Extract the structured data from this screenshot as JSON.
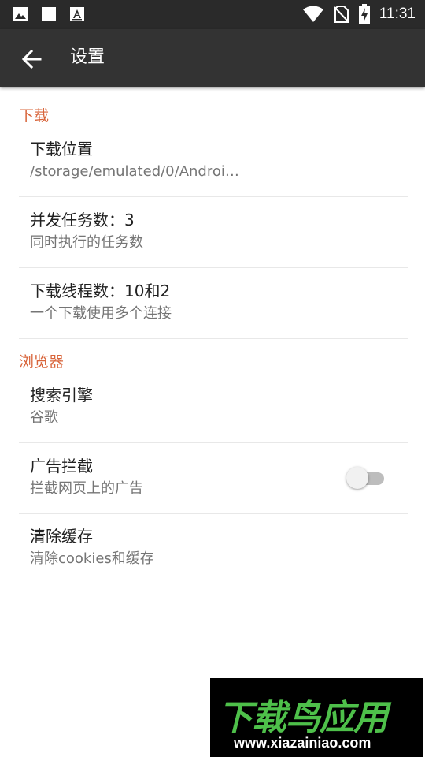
{
  "status_bar": {
    "time": "11:31",
    "left_icons": [
      "image-icon",
      "square-icon",
      "font-icon"
    ],
    "right_icons": [
      "wifi-icon",
      "no-sim-icon",
      "battery-charging-icon"
    ]
  },
  "app_bar": {
    "title": "设置",
    "back_icon": "arrow-back-icon"
  },
  "sections": {
    "download": {
      "header": "下载",
      "items": [
        {
          "title": "下载位置",
          "summary": "/storage/emulated/0/Androi…"
        },
        {
          "title": "并发任务数：3",
          "summary": "同时执行的任务数"
        },
        {
          "title": "下载线程数：10和2",
          "summary": "一个下载使用多个连接"
        }
      ]
    },
    "browser": {
      "header": "浏览器",
      "items": [
        {
          "title": "搜索引擎",
          "summary": "谷歌"
        },
        {
          "title": "广告拦截",
          "summary": "拦截网页上的广告",
          "toggle": false
        },
        {
          "title": "清除缓存",
          "summary": "清除cookies和缓存"
        }
      ]
    }
  },
  "watermark": {
    "logo": "下载鸟应用",
    "url": "www.xiazainiao.com"
  },
  "colors": {
    "accent": "#d8643a",
    "app_bar": "#333333",
    "status_bar": "#2a2a2a",
    "watermark_green": "#4ec04a"
  }
}
